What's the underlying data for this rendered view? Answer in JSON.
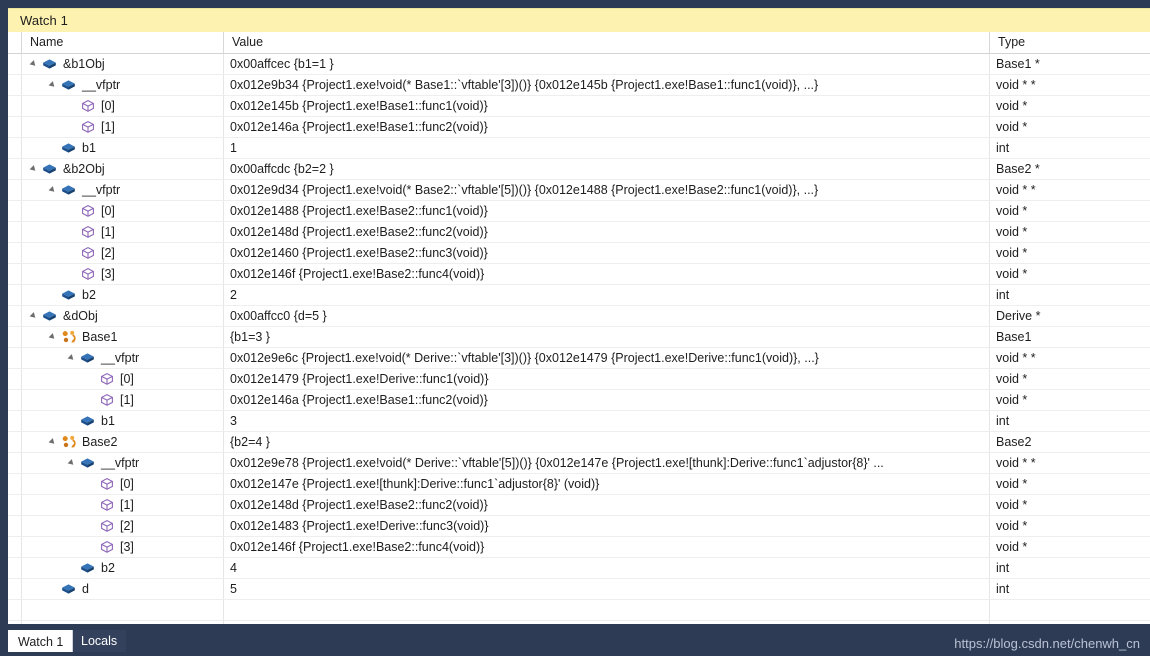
{
  "window": {
    "title": "Watch 1"
  },
  "columns": {
    "gutter": "",
    "name": "Name",
    "value": "Value",
    "type": "Type"
  },
  "rows": [
    {
      "depth": 0,
      "expander": "open",
      "icon": "field-icon",
      "name": "&b1Obj",
      "value": "0x00affcec {b1=1 }",
      "type": "Base1 *"
    },
    {
      "depth": 1,
      "expander": "open",
      "icon": "field-icon",
      "name": "__vfptr",
      "value": "0x012e9b34 {Project1.exe!void(* Base1::`vftable'[3])()} {0x012e145b {Project1.exe!Base1::func1(void)}, ...}",
      "type": "void * *"
    },
    {
      "depth": 2,
      "expander": "none",
      "icon": "array-element-icon",
      "name": "[0]",
      "value": "0x012e145b {Project1.exe!Base1::func1(void)}",
      "type": "void *"
    },
    {
      "depth": 2,
      "expander": "none",
      "icon": "array-element-icon",
      "name": "[1]",
      "value": "0x012e146a {Project1.exe!Base1::func2(void)}",
      "type": "void *"
    },
    {
      "depth": 1,
      "expander": "none",
      "icon": "field-icon",
      "name": "b1",
      "value": "1",
      "type": "int"
    },
    {
      "depth": 0,
      "expander": "open",
      "icon": "field-icon",
      "name": "&b2Obj",
      "value": "0x00affcdc {b2=2 }",
      "type": "Base2 *"
    },
    {
      "depth": 1,
      "expander": "open",
      "icon": "field-icon",
      "name": "__vfptr",
      "value": "0x012e9d34 {Project1.exe!void(* Base2::`vftable'[5])()} {0x012e1488 {Project1.exe!Base2::func1(void)}, ...}",
      "type": "void * *"
    },
    {
      "depth": 2,
      "expander": "none",
      "icon": "array-element-icon",
      "name": "[0]",
      "value": "0x012e1488 {Project1.exe!Base2::func1(void)}",
      "type": "void *"
    },
    {
      "depth": 2,
      "expander": "none",
      "icon": "array-element-icon",
      "name": "[1]",
      "value": "0x012e148d {Project1.exe!Base2::func2(void)}",
      "type": "void *"
    },
    {
      "depth": 2,
      "expander": "none",
      "icon": "array-element-icon",
      "name": "[2]",
      "value": "0x012e1460 {Project1.exe!Base2::func3(void)}",
      "type": "void *"
    },
    {
      "depth": 2,
      "expander": "none",
      "icon": "array-element-icon",
      "name": "[3]",
      "value": "0x012e146f {Project1.exe!Base2::func4(void)}",
      "type": "void *"
    },
    {
      "depth": 1,
      "expander": "none",
      "icon": "field-icon",
      "name": "b2",
      "value": "2",
      "type": "int"
    },
    {
      "depth": 0,
      "expander": "open",
      "icon": "field-icon",
      "name": "&dObj",
      "value": "0x00affcc0 {d=5 }",
      "type": "Derive *"
    },
    {
      "depth": 1,
      "expander": "open",
      "icon": "base-class-icon",
      "name": "Base1",
      "value": "{b1=3 }",
      "type": "Base1"
    },
    {
      "depth": 2,
      "expander": "open",
      "icon": "field-icon",
      "name": "__vfptr",
      "value": "0x012e9e6c {Project1.exe!void(* Derive::`vftable'[3])()} {0x012e1479 {Project1.exe!Derive::func1(void)}, ...}",
      "type": "void * *"
    },
    {
      "depth": 3,
      "expander": "none",
      "icon": "array-element-icon",
      "name": "[0]",
      "value": "0x012e1479 {Project1.exe!Derive::func1(void)}",
      "type": "void *"
    },
    {
      "depth": 3,
      "expander": "none",
      "icon": "array-element-icon",
      "name": "[1]",
      "value": "0x012e146a {Project1.exe!Base1::func2(void)}",
      "type": "void *"
    },
    {
      "depth": 2,
      "expander": "none",
      "icon": "field-icon",
      "name": "b1",
      "value": "3",
      "type": "int"
    },
    {
      "depth": 1,
      "expander": "open",
      "icon": "base-class-icon",
      "name": "Base2",
      "value": "{b2=4 }",
      "type": "Base2"
    },
    {
      "depth": 2,
      "expander": "open",
      "icon": "field-icon",
      "name": "__vfptr",
      "value": "0x012e9e78 {Project1.exe!void(* Derive::`vftable'[5])()} {0x012e147e {Project1.exe![thunk]:Derive::func1`adjustor{8}' ...",
      "type": "void * *"
    },
    {
      "depth": 3,
      "expander": "none",
      "icon": "array-element-icon",
      "name": "[0]",
      "value": "0x012e147e {Project1.exe![thunk]:Derive::func1`adjustor{8}' (void)}",
      "type": "void *"
    },
    {
      "depth": 3,
      "expander": "none",
      "icon": "array-element-icon",
      "name": "[1]",
      "value": "0x012e148d {Project1.exe!Base2::func2(void)}",
      "type": "void *"
    },
    {
      "depth": 3,
      "expander": "none",
      "icon": "array-element-icon",
      "name": "[2]",
      "value": "0x012e1483 {Project1.exe!Derive::func3(void)}",
      "type": "void *"
    },
    {
      "depth": 3,
      "expander": "none",
      "icon": "array-element-icon",
      "name": "[3]",
      "value": "0x012e146f {Project1.exe!Base2::func4(void)}",
      "type": "void *"
    },
    {
      "depth": 2,
      "expander": "none",
      "icon": "field-icon",
      "name": "b2",
      "value": "4",
      "type": "int"
    },
    {
      "depth": 1,
      "expander": "none",
      "icon": "field-icon",
      "name": "d",
      "value": "5",
      "type": "int"
    }
  ],
  "tabs": [
    {
      "label": "Watch 1",
      "active": true
    },
    {
      "label": "Locals",
      "active": false
    }
  ],
  "watermark": "https://blog.csdn.net/chenwh_cn",
  "colors": {
    "title_bar": "#fdf2b0",
    "shell": "#2e3b55",
    "grid_bg": "#ffffff",
    "field_icon": "#1f5fa9",
    "array_icon": "#8e67b8",
    "base_class_icon": "#e08a1e",
    "text": "#1e1e1e",
    "watermark": "#b9c2d4"
  }
}
